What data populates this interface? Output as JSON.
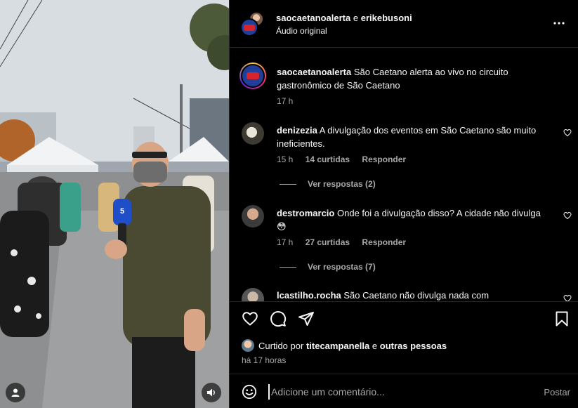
{
  "colors": {
    "panel_bg": "#000000",
    "secondary_text": "#a8a8a8",
    "primary_text": "#f5f5f5",
    "divider": "#262626"
  },
  "header": {
    "user1": "saocaetanoalerta",
    "conjunction": "e",
    "user2": "erikebusoni",
    "audio": "Áudio original"
  },
  "caption": {
    "username": "saocaetanoalerta",
    "text": "São Caetano alerta ao vivo no circuito gastronômico de São Caetano",
    "time": "17 h"
  },
  "comments": [
    {
      "username": "denizezia",
      "text": "A divulgação dos eventos em São Caetano são muito ineficientes.",
      "time": "15 h",
      "likes": "14 curtidas",
      "reply": "Responder",
      "view_replies": "Ver respostas (2)"
    },
    {
      "username": "destromarcio",
      "text": "Onde foi a divulgação disso? A cidade não divulga 😳",
      "time": "17 h",
      "likes": "27 curtidas",
      "reply": "Responder",
      "view_replies": "Ver respostas (7)"
    },
    {
      "username": "lcastilho.rocha",
      "text": "São Caetano não divulga nada com"
    }
  ],
  "likes": {
    "prefix": "Curtido por",
    "user": "titecampanella",
    "joiner": "e",
    "others": "outras pessoas"
  },
  "timestamp": "há 17 horas",
  "composer": {
    "placeholder": "Adicione um comentário...",
    "post": "Postar"
  },
  "media": {
    "mic_label": "5"
  },
  "icons": [
    "user-tag-icon",
    "audio-icon",
    "more-icon",
    "heart-icon",
    "comment-icon",
    "share-icon",
    "bookmark-icon",
    "emoji-icon"
  ]
}
